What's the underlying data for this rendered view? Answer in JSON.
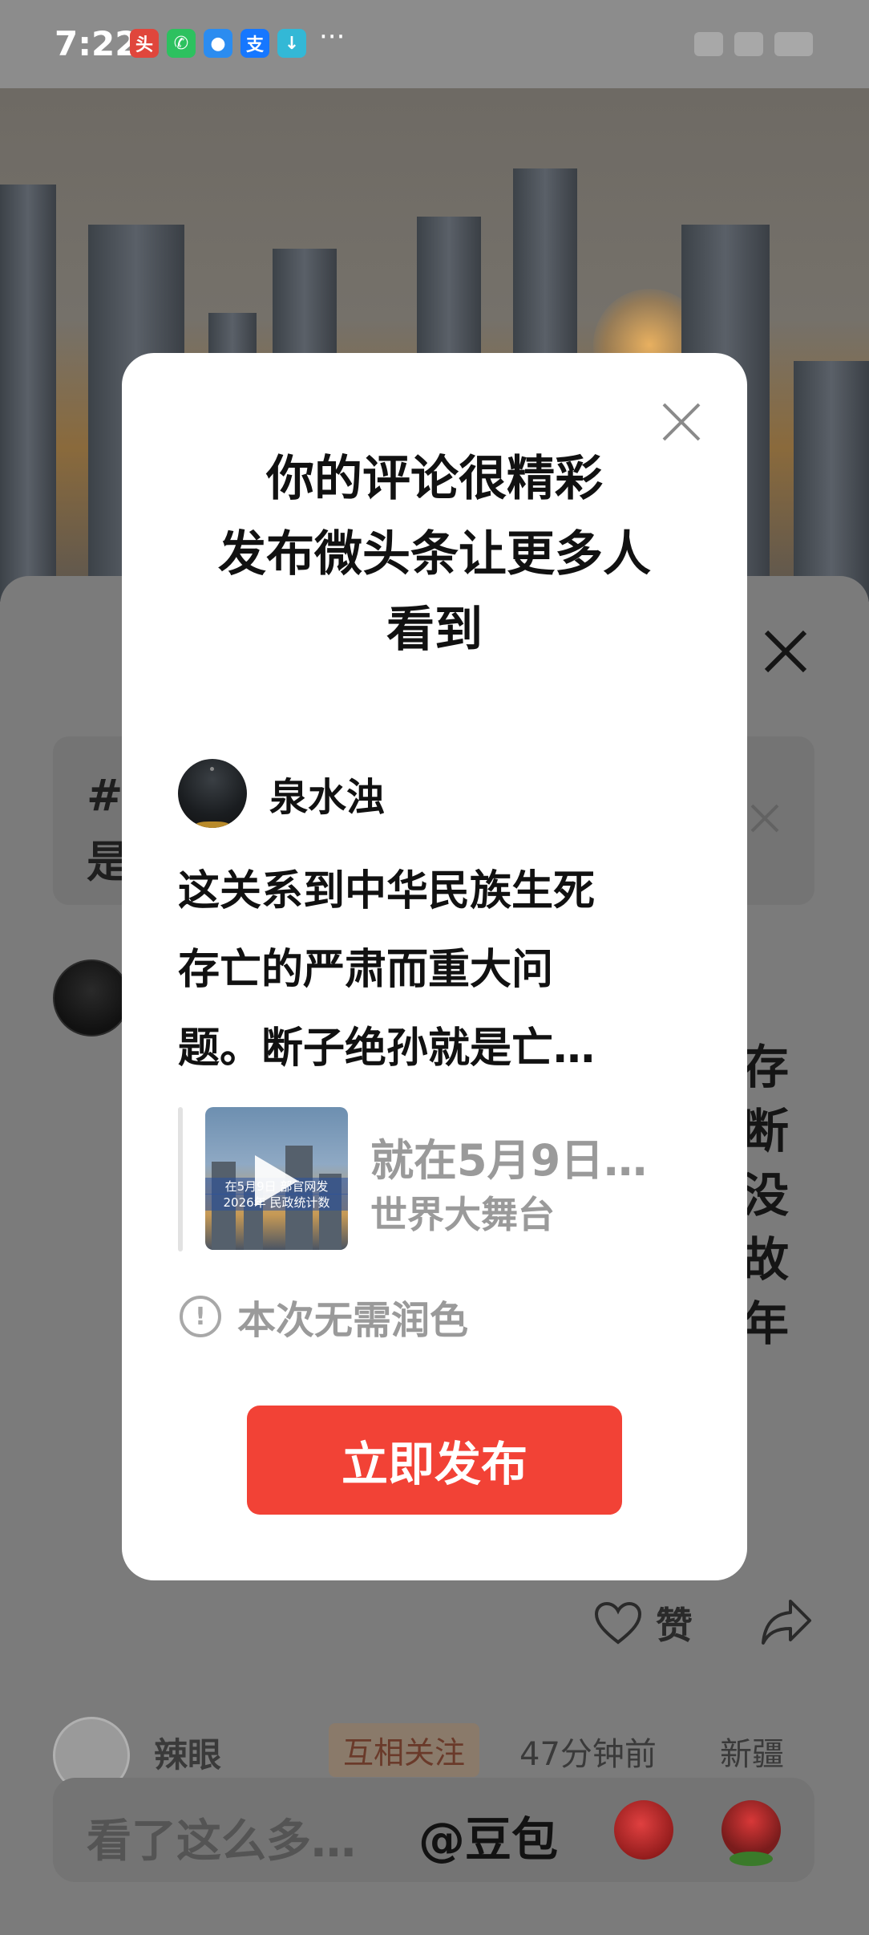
{
  "status_bar": {
    "time": "7:22",
    "app_icons": [
      {
        "icon": "red-app-icon",
        "color": "#e0463c",
        "glyph": "头"
      },
      {
        "icon": "wechat-icon",
        "color": "#2dc15f",
        "glyph": "✆"
      },
      {
        "icon": "message-icon",
        "color": "#2b8cf0",
        "glyph": "●"
      },
      {
        "icon": "alipay-icon",
        "color": "#1677ff",
        "glyph": "支"
      },
      {
        "icon": "download-icon",
        "color": "#33b8d6",
        "glyph": "↓"
      }
    ],
    "more": "···"
  },
  "background": {
    "topic_hash": "#",
    "topic_first_char": "是",
    "right_chars": [
      "存",
      "断",
      "没",
      "故",
      "年"
    ],
    "like_label": "赞",
    "next_comment": {
      "name": "辣眼",
      "tag": "互相关注",
      "time": "47分钟前",
      "location": "新疆"
    },
    "input_placeholder": "看了这么多…",
    "input_mention": "@豆包"
  },
  "dialog": {
    "title_lines": [
      "你的评论很精彩",
      "发布微头条让更多人",
      "看到"
    ],
    "author_name": "泉水浊",
    "comment_lines": [
      "这关系到中华民族生死",
      "存亡的严肃而重大问",
      "题。断子绝孙就是亡…"
    ],
    "quote": {
      "thumb_caption_top": "在5月9日 部官网发",
      "thumb_caption_bottom": "2026年 民政统计数",
      "title": "就在5月9日…",
      "source": "世界大舞台"
    },
    "notice": "本次无需润色",
    "publish_button": "立即发布"
  },
  "colors": {
    "accent": "#f24236",
    "overlay": "#7b7b7b",
    "muted_text": "#9a9a9a"
  }
}
